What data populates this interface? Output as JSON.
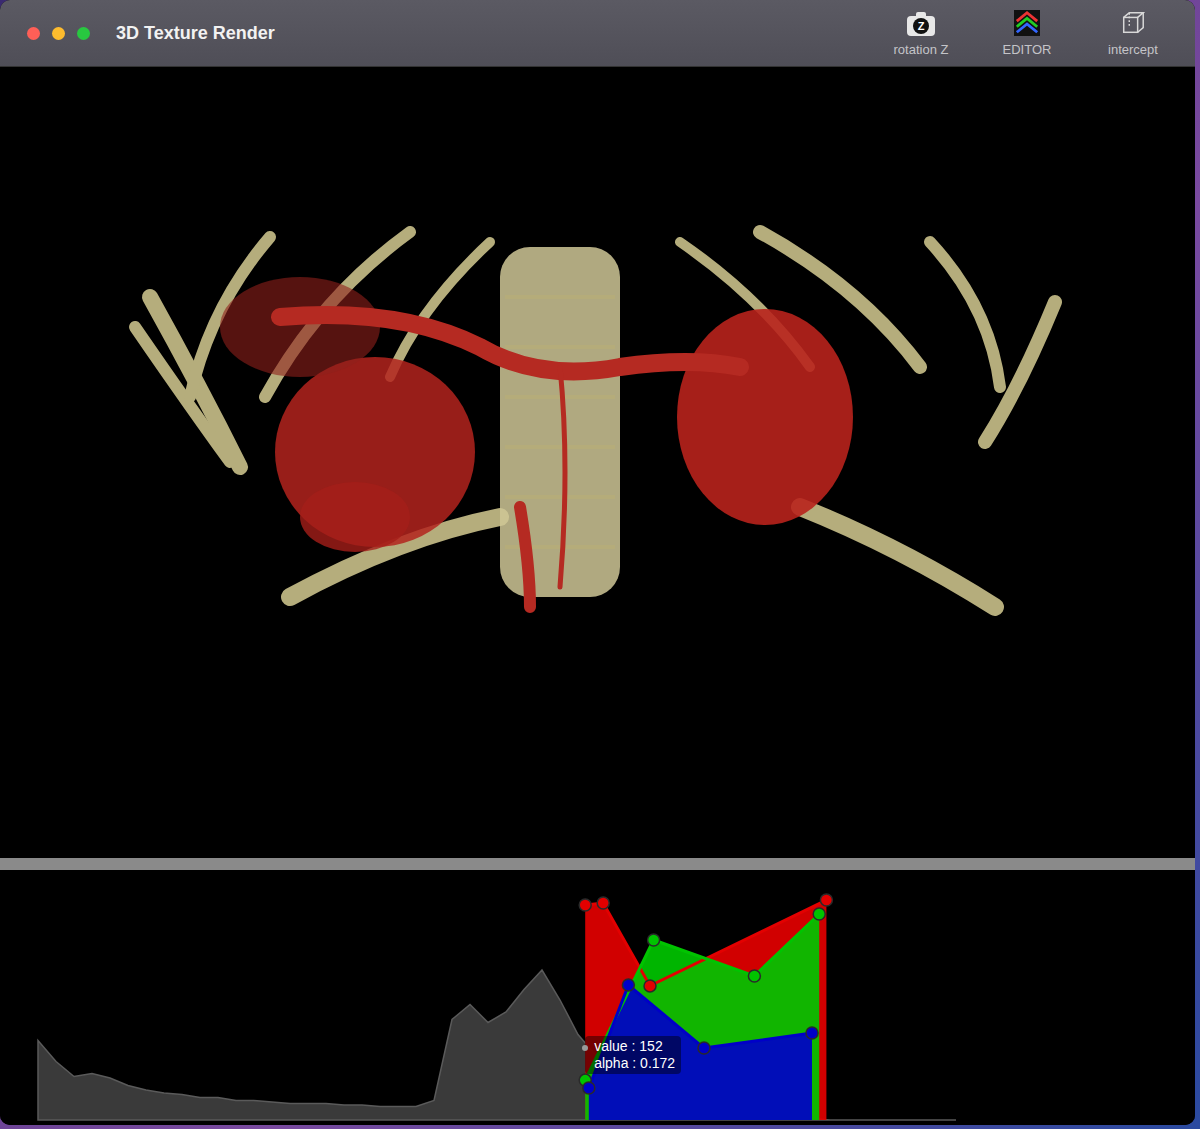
{
  "window": {
    "title": "3D Texture Render"
  },
  "toolbar": [
    {
      "label": "rotation Z",
      "kind": "camera",
      "badge": "Z"
    },
    {
      "label": "EDITOR",
      "kind": "transfer"
    },
    {
      "label": "intercept",
      "kind": "cube"
    }
  ],
  "transfer_function": {
    "histogram": [
      53,
      39,
      29,
      31,
      28,
      23,
      20,
      18,
      17,
      15,
      15,
      13,
      13,
      12,
      11,
      11,
      11,
      10,
      10,
      9,
      9,
      9,
      13,
      67,
      77,
      65,
      72,
      87,
      100,
      80,
      57,
      43,
      37,
      33,
      32,
      27,
      21,
      19,
      16,
      13,
      11,
      8,
      4,
      1,
      0,
      0,
      0,
      0,
      0,
      0,
      0,
      0
    ],
    "channels": [
      {
        "color": "#e30000",
        "points": [
          {
            "value": 152,
            "alpha": 0.927
          },
          {
            "value": 157,
            "alpha": 0.935
          },
          {
            "value": 170,
            "alpha": 0.578
          },
          {
            "value": 219,
            "alpha": 0.948
          }
        ]
      },
      {
        "color": "#00c400",
        "points": [
          {
            "value": 152,
            "alpha": 0.172
          },
          {
            "value": 171,
            "alpha": 0.776
          },
          {
            "value": 199,
            "alpha": 0.621
          },
          {
            "value": 217,
            "alpha": 0.888
          }
        ]
      },
      {
        "color": "#0000c8",
        "points": [
          {
            "value": 153,
            "alpha": 0.138
          },
          {
            "value": 164,
            "alpha": 0.582
          },
          {
            "value": 185,
            "alpha": 0.31
          },
          {
            "value": 215,
            "alpha": 0.375
          }
        ]
      }
    ],
    "tooltip": {
      "value": 152,
      "alpha": 0.172,
      "value_label": "value : 152",
      "alpha_label": "alpha : 0.172"
    }
  }
}
